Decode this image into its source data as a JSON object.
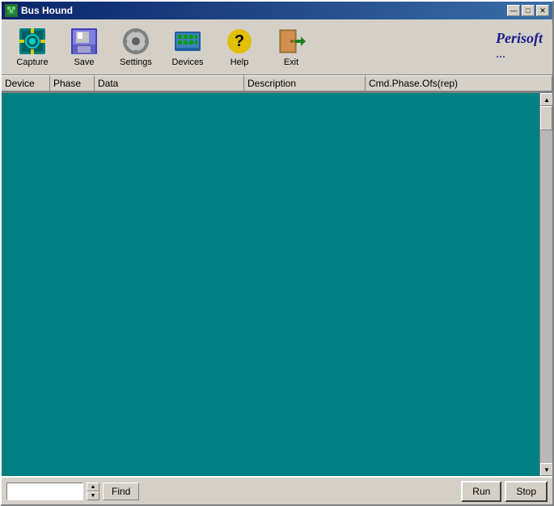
{
  "window": {
    "title": "Bus Hound",
    "titleControls": {
      "minimize": "—",
      "maximize": "□",
      "close": "✕"
    }
  },
  "toolbar": {
    "buttons": [
      {
        "id": "capture",
        "label": "Capture"
      },
      {
        "id": "save",
        "label": "Save"
      },
      {
        "id": "settings",
        "label": "Settings"
      },
      {
        "id": "devices",
        "label": "Devices"
      },
      {
        "id": "help",
        "label": "Help"
      },
      {
        "id": "exit",
        "label": "Exit"
      }
    ],
    "logo": "Perisoft",
    "logoDots": "···"
  },
  "columns": [
    {
      "id": "device",
      "label": "Device"
    },
    {
      "id": "phase",
      "label": "Phase"
    },
    {
      "id": "data",
      "label": "Data"
    },
    {
      "id": "description",
      "label": "Description"
    },
    {
      "id": "cmd",
      "label": "Cmd.Phase.Ofs(rep)"
    }
  ],
  "bottomBar": {
    "searchPlaceholder": "",
    "findLabel": "Find",
    "runLabel": "Run",
    "stopLabel": "Stop"
  }
}
